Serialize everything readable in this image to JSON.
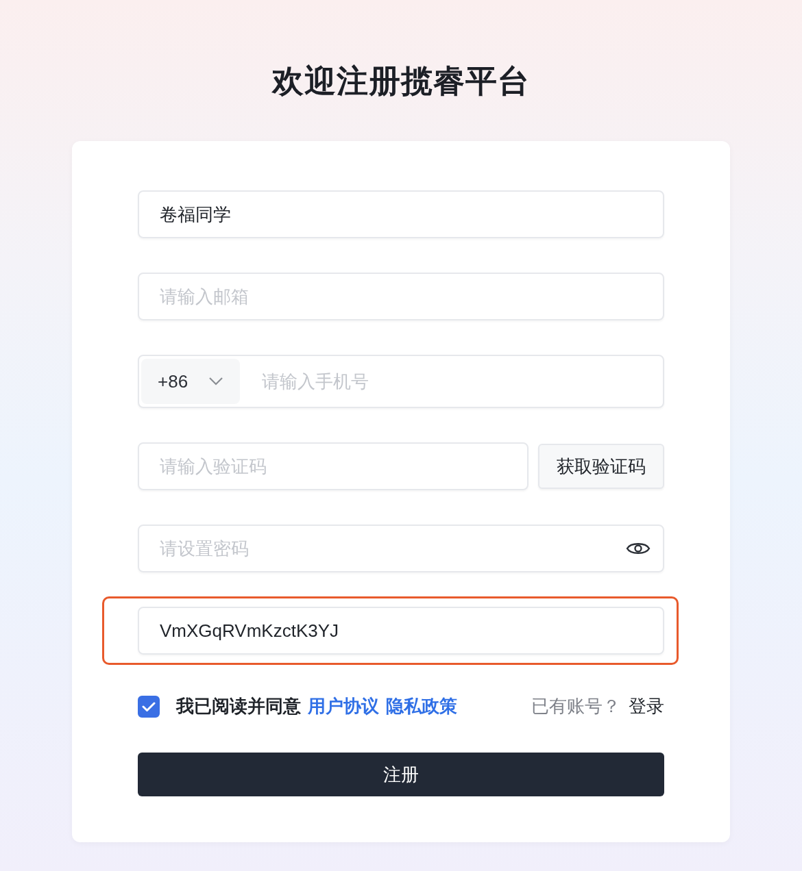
{
  "title": "欢迎注册揽睿平台",
  "fields": [
    {
      "kind": "text",
      "value": "卷福同学",
      "highlighted": false
    },
    {
      "kind": "text",
      "placeholder": "请输入邮箱",
      "highlighted": false
    },
    {
      "kind": "phone",
      "prefix": "+86",
      "placeholder": "请输入手机号",
      "highlighted": false
    },
    {
      "kind": "code",
      "placeholder": "请输入验证码",
      "button": "获取验证码",
      "highlighted": false
    },
    {
      "kind": "password",
      "placeholder": "请设置密码",
      "highlighted": false
    },
    {
      "kind": "text",
      "value": "VmXGqRVmKzctK3YJ",
      "highlighted": true
    }
  ],
  "agreement": {
    "checked": true,
    "text": "我已阅读并同意",
    "links": [
      "用户协议",
      "隐私政策"
    ]
  },
  "login": {
    "prompt": "已有账号？",
    "link": "登录"
  },
  "submit": "注册"
}
